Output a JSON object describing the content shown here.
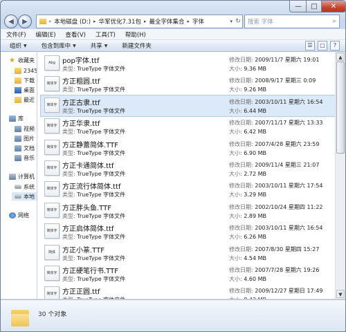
{
  "window": {
    "title_controls": {
      "minimize": "—",
      "maximize": "□",
      "close": "✕"
    }
  },
  "address": {
    "segments": [
      "本地磁盘 (D:)",
      "华军优化7.31包",
      "最全字体集合",
      "字体"
    ],
    "overflow": "«"
  },
  "search": {
    "placeholder": "搜索 字体"
  },
  "menu": [
    "文件(F)",
    "编辑(E)",
    "查看(V)",
    "工具(T)",
    "帮助(H)"
  ],
  "toolbar": {
    "organize": "组织",
    "include": "包含到库中",
    "share": "共享",
    "new_folder": "新建文件夹"
  },
  "nav": {
    "favorites": "收藏夹",
    "fav_items": [
      "2345",
      "下载",
      "桌面",
      "最近"
    ],
    "libraries": "库",
    "lib_items": [
      "视频",
      "图片",
      "文档",
      "音乐"
    ],
    "computer": "计算机",
    "comp_items": [
      "系统",
      "本地"
    ],
    "network": "网络"
  },
  "labels": {
    "type": "类型:",
    "date": "修改日期:",
    "size": "大小:"
  },
  "files": [
    {
      "name": "pop字体.ttf",
      "thumb": "Abg",
      "type": "TrueType 字体文件",
      "date": "2009/11/7 星期六 19:01",
      "size": "9.36 MB"
    },
    {
      "name": "方正粗圆.ttf",
      "thumb": "简体字",
      "type": "TrueType 字体文件",
      "date": "2008/9/17 星期三 0:09",
      "size": "9.26 MB"
    },
    {
      "name": "方正古隶.ttf",
      "thumb": "简体字",
      "type": "TrueType 字体文件",
      "date": "2003/10/11 星期六 16:54",
      "size": "6.44 MB"
    },
    {
      "name": "方正华隶.ttf",
      "thumb": "简体字",
      "type": "TrueType 字体文件",
      "date": "2007/11/17 星期六 13:33",
      "size": "6.42 MB"
    },
    {
      "name": "方正静蕾简体.TTF",
      "thumb": "简体字",
      "type": "TrueType 字体文件",
      "date": "2007/4/28 星期六 23:59",
      "size": "6.90 MB"
    },
    {
      "name": "方正卡通简体.ttf",
      "thumb": "简体字",
      "type": "TrueType 字体文件",
      "date": "2009/11/4 星期三 21:07",
      "size": "2.72 MB"
    },
    {
      "name": "方正流行体简体.ttf",
      "thumb": "简体字",
      "type": "TrueType 字体文件",
      "date": "2003/10/11 星期六 17:54",
      "size": "3.29 MB"
    },
    {
      "name": "方正胖头鱼.TTF",
      "thumb": "简体字",
      "type": "TrueType 字体文件",
      "date": "2002/10/24 星期四 11:22",
      "size": "2.89 MB"
    },
    {
      "name": "方正启体简体.ttf",
      "thumb": "简体字",
      "type": "TrueType 字体文件",
      "date": "2003/10/11 星期六 16:54",
      "size": "6.26 MB"
    },
    {
      "name": "方正小篆.TTF",
      "thumb": "简体",
      "type": "TrueType 字体文件",
      "date": "2007/8/30 星期四 15:27",
      "size": "4.54 MB"
    },
    {
      "name": "方正硬笔行书.TTF",
      "thumb": "简体字",
      "type": "TrueType 字体文件",
      "date": "2007/7/28 星期六 19:26",
      "size": "4.60 MB"
    },
    {
      "name": "方正正圆.ttf",
      "thumb": "简体字",
      "type": "TrueType 字体文件",
      "date": "2009/12/27 星期日 17:49",
      "size": "8.43 MB"
    }
  ],
  "status": {
    "count": "30 个对象"
  }
}
